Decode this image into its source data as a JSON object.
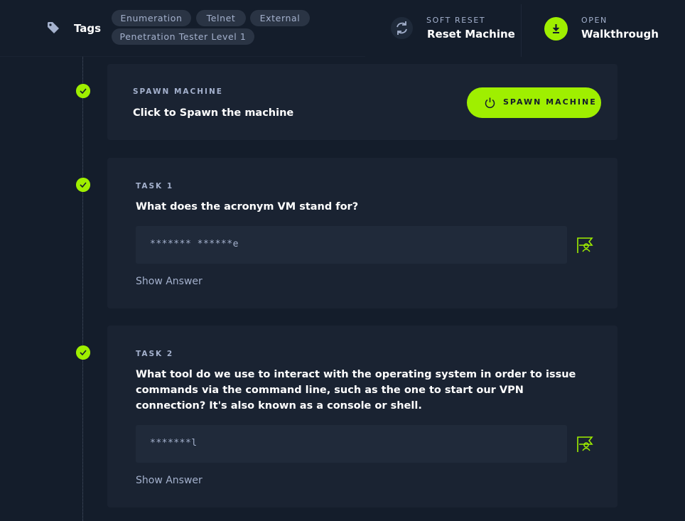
{
  "header": {
    "tags_label": "Tags",
    "tags": [
      "Enumeration",
      "Telnet",
      "External",
      "Penetration Tester Level 1"
    ],
    "reset": {
      "sub": "SOFT RESET",
      "main": "Reset Machine",
      "icon": "refresh-icon"
    },
    "walkthrough": {
      "sub": "OPEN",
      "main": "Walkthrough",
      "icon": "download-icon"
    }
  },
  "spawn": {
    "label": "SPAWN MACHINE",
    "text": "Click to Spawn the machine",
    "button_label": "SPAWN MACHINE",
    "button_icon": "power-icon"
  },
  "tasks": [
    {
      "label": "TASK 1",
      "question": "What does the acronym VM stand for?",
      "answer_placeholder": "******* ******e",
      "show_answer": "Show Answer"
    },
    {
      "label": "TASK 2",
      "question_lines": [
        "What tool do we use to interact with the operating system in order to issue",
        "commands via the command line, such as the one to start our VPN",
        "connection? It's also known as a console or shell."
      ],
      "answer_placeholder": "*******l",
      "show_answer": "Show Answer"
    }
  ],
  "colors": {
    "background": "#141d2b",
    "card": "#1a2332",
    "accent": "#9fef00",
    "muted_text": "#a4b1cd"
  }
}
